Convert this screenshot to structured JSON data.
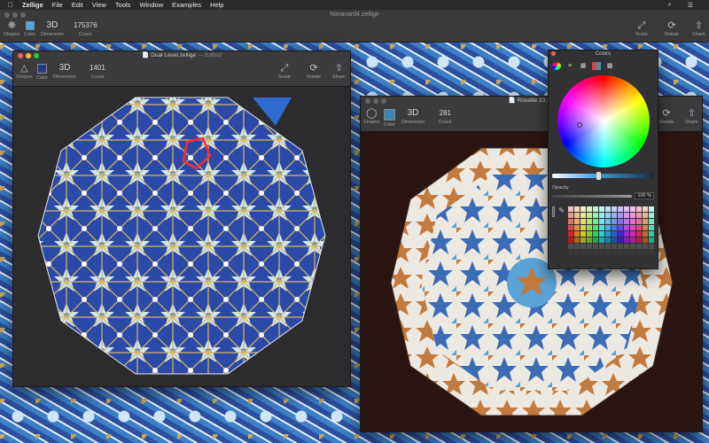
{
  "menubar": {
    "apple": "",
    "app_name": "Zellige",
    "menus": [
      "File",
      "Edit",
      "View",
      "Tools",
      "Window",
      "Examples",
      "Help"
    ]
  },
  "main_window": {
    "title": "Nimavard4.zellige",
    "toolbar": {
      "shapes": "Shapes",
      "color": "Color",
      "dimension_value": "3D",
      "dimension": "Dimension",
      "count_value": "175376",
      "count": "Count",
      "scale": "Scale",
      "rotate": "Rotate",
      "share": "Share"
    }
  },
  "doc1": {
    "title": "Dual Level.zellige",
    "title_suffix": "— Edited",
    "toolbar": {
      "shapes": "Shapes",
      "color": "Color",
      "dimension_value": "3D",
      "dimension": "Dimension",
      "count_value": "1401",
      "count": "Count",
      "scale": "Scale",
      "rotate": "Rotate",
      "share": "Share"
    }
  },
  "doc2": {
    "title": "Rosette 10.zel",
    "toolbar": {
      "shapes": "Shapes",
      "color": "Color",
      "dimension_value": "3D",
      "dimension": "Dimension",
      "count_value": "281",
      "count": "Count",
      "rotate": "Rotate",
      "share": "Share"
    }
  },
  "colors_panel": {
    "title": "Colors",
    "opacity_label": "Opacity",
    "opacity_value": "100 %"
  },
  "colors": {
    "accent_blue": "#2b4aa8",
    "tile_blue": "#3a78c2",
    "tile_light": "#cfe7f7",
    "tile_gold": "#d8b75e",
    "tile_orange": "#c27a3e",
    "tile_white": "#ece9e2",
    "swatch_doc1": "#243b8a",
    "swatch_doc2": "#3a86b8",
    "swatch_main": "#4aa9e0",
    "canvas_dark": "#2b1512",
    "highlight": "#ff2a2a"
  },
  "icons": [
    "apple-icon",
    "search-icon",
    "list-icon",
    "shapes-icon",
    "scale-icon",
    "rotate-icon",
    "share-icon",
    "color-wheel-icon",
    "eyedropper-icon"
  ]
}
